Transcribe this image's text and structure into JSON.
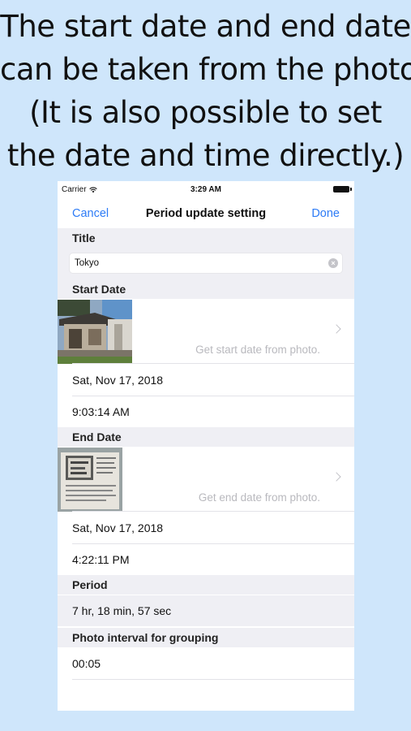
{
  "caption": {
    "lines": [
      "The start date and end date",
      "can be taken from the photo.",
      "(It is also possible to set",
      "the date and time directly.)"
    ]
  },
  "status_bar": {
    "carrier": "Carrier",
    "time": "3:29 AM"
  },
  "nav": {
    "cancel_label": "Cancel",
    "title": "Period update setting",
    "done_label": "Done"
  },
  "title_section": {
    "header": "Title",
    "value": "Tokyo"
  },
  "start_section": {
    "header": "Start Date",
    "photo_hint": "Get start date from photo.",
    "date": "Sat, Nov 17, 2018",
    "time": "9:03:14 AM"
  },
  "end_section": {
    "header": "End Date",
    "photo_hint": "Get end date from photo.",
    "date": "Sat, Nov 17, 2018",
    "time": "4:22:11 PM"
  },
  "period_section": {
    "header": "Period",
    "value": "7 hr, 18 min, 57 sec"
  },
  "grouping_section": {
    "header": "Photo interval for grouping",
    "value": "00:05"
  },
  "colors": {
    "accent": "#2e7cf6",
    "background": "#cfe6fb",
    "section_gray": "#efeff4"
  }
}
